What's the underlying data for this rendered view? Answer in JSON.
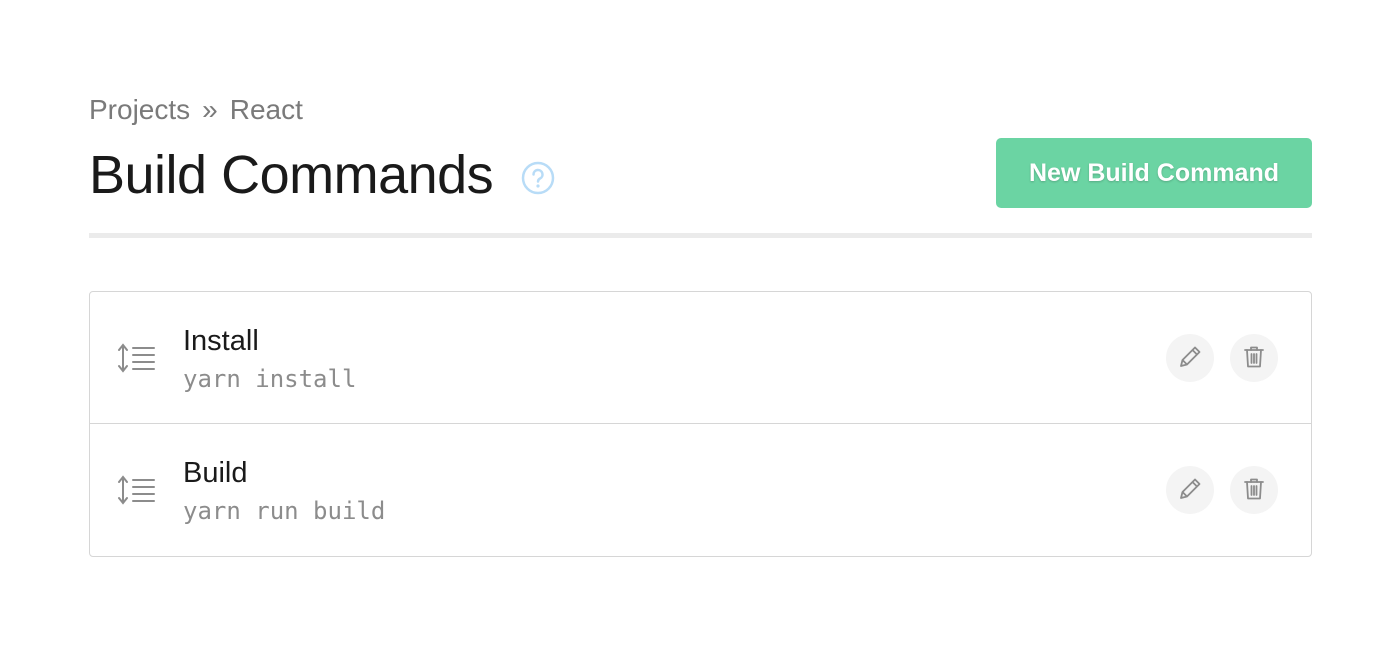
{
  "breadcrumb": {
    "items": [
      "Projects",
      "React"
    ],
    "separator": "»"
  },
  "header": {
    "title": "Build Commands",
    "help_icon": "question-circle-icon",
    "new_button_label": "New Build Command"
  },
  "colors": {
    "accent": "#6bd4a3",
    "help_icon": "#b8dcf7"
  },
  "build_commands": [
    {
      "name": "Install",
      "command": "yarn install",
      "icons": [
        "drag-handle-icon",
        "pencil-icon",
        "trash-icon"
      ]
    },
    {
      "name": "Build",
      "command": "yarn run build",
      "icons": [
        "drag-handle-icon",
        "pencil-icon",
        "trash-icon"
      ]
    }
  ]
}
